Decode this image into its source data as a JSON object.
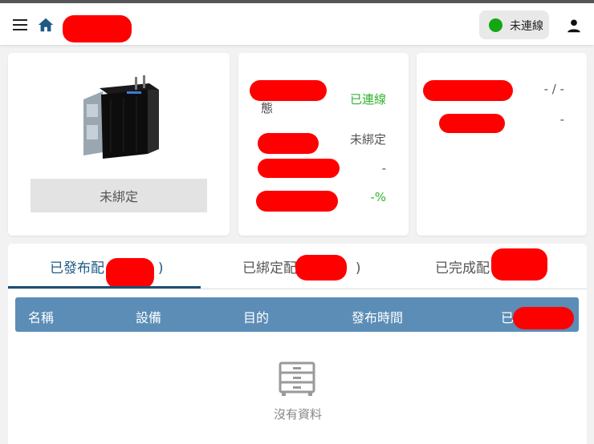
{
  "header": {
    "menu_icon": "menu-icon",
    "home_icon": "home-icon",
    "connection_status": "未連線",
    "status_color": "#14a714",
    "user_icon": "user-icon"
  },
  "device_card": {
    "bind_button_label": "未綁定"
  },
  "status_card": {
    "row1_label_fragment": "態",
    "row1_value": "已連線",
    "row2_value": "未綁定",
    "row3_value": "-",
    "row4_value": "-%"
  },
  "count_card": {
    "row1_value": "- / -",
    "row2_value": "-"
  },
  "tabs": [
    {
      "label": "已發布配",
      "suffix": ")"
    },
    {
      "label": "已綁定配",
      "suffix": ")"
    },
    {
      "label": "已完成配",
      "suffix": ""
    }
  ],
  "table": {
    "columns": [
      "名稱",
      "設備",
      "目的",
      "發布時間",
      "已"
    ],
    "header_color": "#5b8db7",
    "empty_text": "沒有資料"
  },
  "accent_color": "#1f5a86"
}
